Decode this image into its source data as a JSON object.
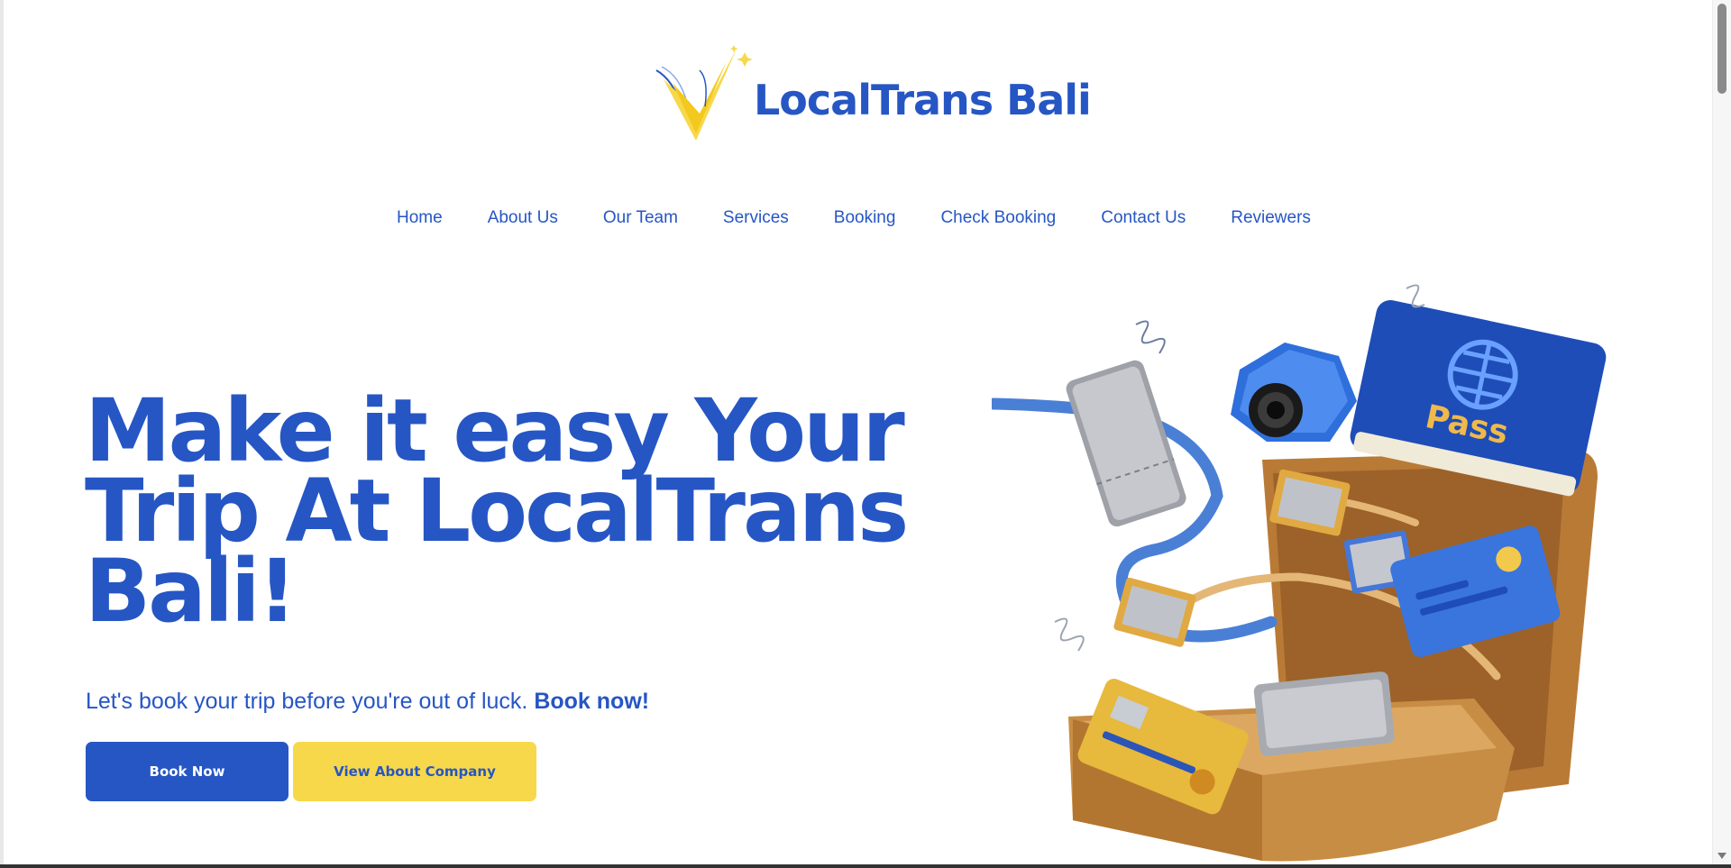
{
  "brand": {
    "name": "LocalTrans Bali",
    "logo_icon": "checkmark-star-icon",
    "colors": {
      "primary": "#2656c4",
      "accent": "#f7d84a"
    }
  },
  "nav": {
    "items": [
      {
        "label": "Home"
      },
      {
        "label": "About Us"
      },
      {
        "label": "Our Team"
      },
      {
        "label": "Services"
      },
      {
        "label": "Booking"
      },
      {
        "label": "Check Booking"
      },
      {
        "label": "Contact Us"
      },
      {
        "label": "Reviewers"
      }
    ]
  },
  "hero": {
    "title": "Make it easy Your Trip At LocalTrans Bali!",
    "subtitle_text": "Let's book your trip before you're out of luck. ",
    "subtitle_emphasis": "Book now!",
    "primary_button": "Book Now",
    "secondary_button": "View About Company",
    "illustration": "travel-suitcase-passport-camera-illustration",
    "illustration_text": "Pass"
  }
}
